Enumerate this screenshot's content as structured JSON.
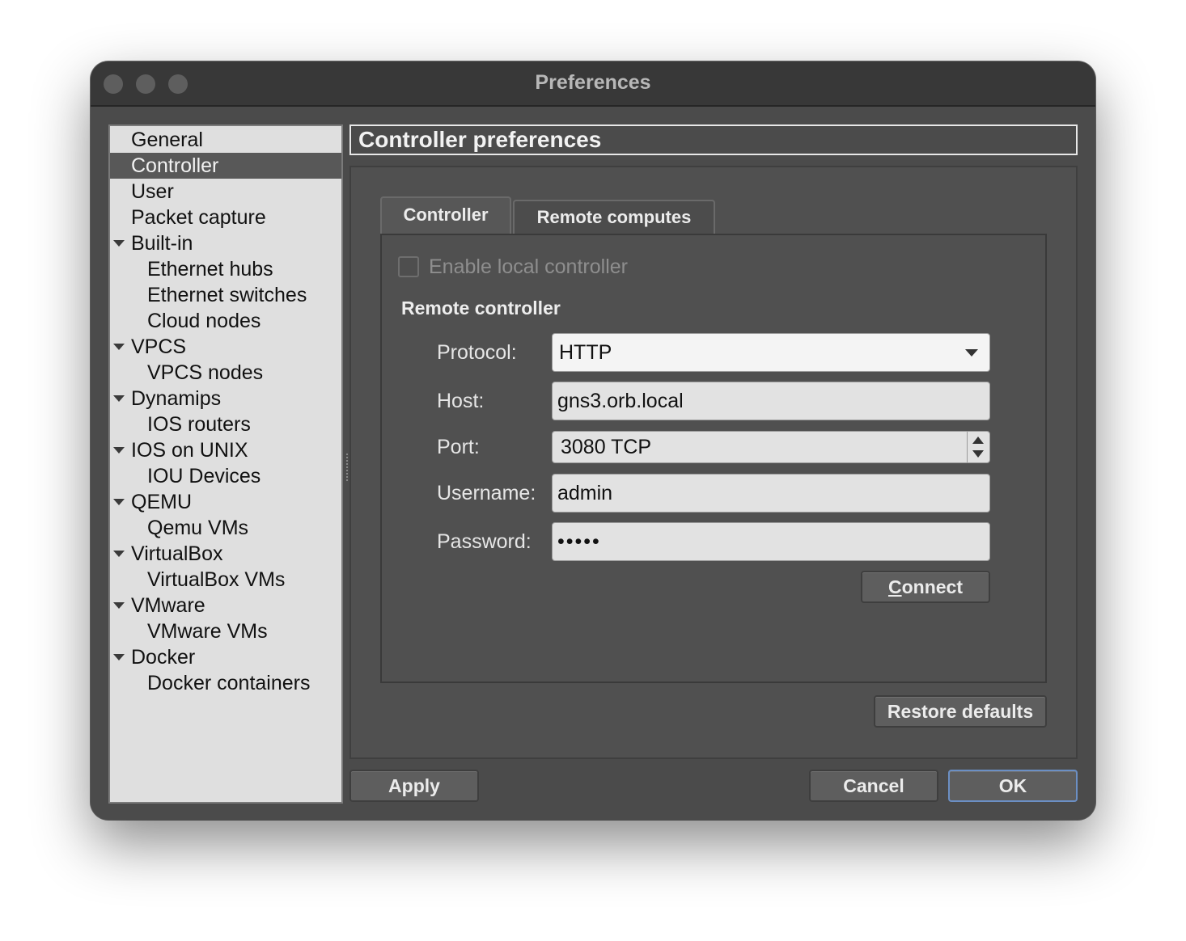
{
  "window": {
    "title": "Preferences"
  },
  "sidebar": {
    "items": [
      {
        "label": "General",
        "level": 0,
        "expandable": false,
        "selected": false
      },
      {
        "label": "Controller",
        "level": 0,
        "expandable": false,
        "selected": true
      },
      {
        "label": "User",
        "level": 0,
        "expandable": false,
        "selected": false
      },
      {
        "label": "Packet capture",
        "level": 0,
        "expandable": false,
        "selected": false
      },
      {
        "label": "Built-in",
        "level": 0,
        "expandable": true,
        "selected": false
      },
      {
        "label": "Ethernet hubs",
        "level": 1,
        "expandable": false,
        "selected": false
      },
      {
        "label": "Ethernet switches",
        "level": 1,
        "expandable": false,
        "selected": false
      },
      {
        "label": "Cloud nodes",
        "level": 1,
        "expandable": false,
        "selected": false
      },
      {
        "label": "VPCS",
        "level": 0,
        "expandable": true,
        "selected": false
      },
      {
        "label": "VPCS nodes",
        "level": 1,
        "expandable": false,
        "selected": false
      },
      {
        "label": "Dynamips",
        "level": 0,
        "expandable": true,
        "selected": false
      },
      {
        "label": "IOS routers",
        "level": 1,
        "expandable": false,
        "selected": false
      },
      {
        "label": "IOS on UNIX",
        "level": 0,
        "expandable": true,
        "selected": false
      },
      {
        "label": "IOU Devices",
        "level": 1,
        "expandable": false,
        "selected": false
      },
      {
        "label": "QEMU",
        "level": 0,
        "expandable": true,
        "selected": false
      },
      {
        "label": "Qemu VMs",
        "level": 1,
        "expandable": false,
        "selected": false
      },
      {
        "label": "VirtualBox",
        "level": 0,
        "expandable": true,
        "selected": false
      },
      {
        "label": "VirtualBox VMs",
        "level": 1,
        "expandable": false,
        "selected": false
      },
      {
        "label": "VMware",
        "level": 0,
        "expandable": true,
        "selected": false
      },
      {
        "label": "VMware VMs",
        "level": 1,
        "expandable": false,
        "selected": false
      },
      {
        "label": "Docker",
        "level": 0,
        "expandable": true,
        "selected": false
      },
      {
        "label": "Docker containers",
        "level": 1,
        "expandable": false,
        "selected": false
      }
    ]
  },
  "main": {
    "header": "Controller preferences",
    "tabs": [
      {
        "label": "Controller",
        "active": true
      },
      {
        "label": "Remote computes",
        "active": false
      }
    ],
    "enable_local_controller": {
      "label": "Enable local controller",
      "checked": false,
      "enabled": false
    },
    "remote_controller": {
      "title": "Remote controller",
      "protocol": {
        "label": "Protocol:",
        "value": "HTTP"
      },
      "host": {
        "label": "Host:",
        "value": "gns3.orb.local"
      },
      "port": {
        "label": "Port:",
        "value": "3080 TCP"
      },
      "username": {
        "label": "Username:",
        "value": "admin"
      },
      "password": {
        "label": "Password:",
        "value": "•••••"
      },
      "connect_button": {
        "mnemonic": "C",
        "rest": "onnect"
      }
    },
    "restore_defaults": "Restore defaults"
  },
  "footer": {
    "apply": "Apply",
    "cancel": "Cancel",
    "ok": "OK"
  },
  "colors": {
    "window_bg": "#4b4b4b",
    "titlebar_bg": "#383838",
    "sidebar_bg": "#dfdfdf",
    "selection_bg": "#585858",
    "default_button_border": "#6b8fc4"
  }
}
